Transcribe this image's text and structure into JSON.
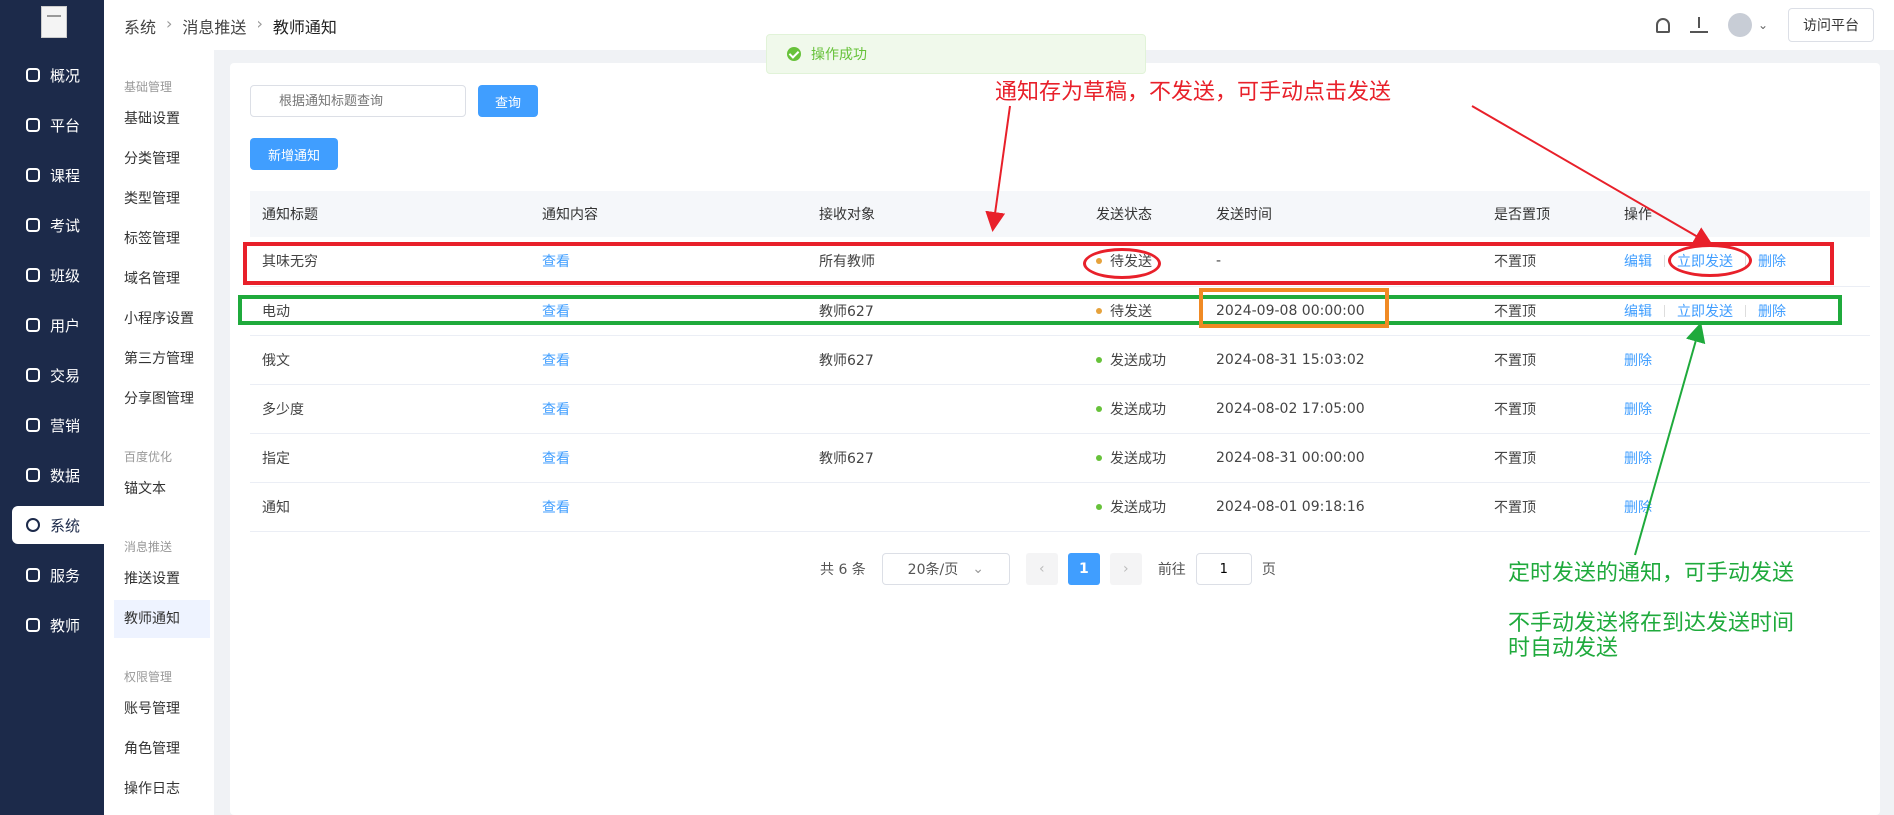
{
  "sidebar": {
    "items": [
      {
        "label": "概况",
        "icon": "pie-chart-icon"
      },
      {
        "label": "平台",
        "icon": "shop-icon"
      },
      {
        "label": "课程",
        "icon": "book-icon"
      },
      {
        "label": "考试",
        "icon": "exam-icon"
      },
      {
        "label": "班级",
        "icon": "group-icon"
      },
      {
        "label": "用户",
        "icon": "user-icon"
      },
      {
        "label": "交易",
        "icon": "yen-icon"
      },
      {
        "label": "营销",
        "icon": "megaphone-icon"
      },
      {
        "label": "数据",
        "icon": "bar-chart-icon"
      },
      {
        "label": "系统",
        "icon": "gear-icon"
      },
      {
        "label": "服务",
        "icon": "handshake-icon"
      },
      {
        "label": "教师",
        "icon": "teacher-icon"
      }
    ]
  },
  "submenu": {
    "group_basic": "基础管理",
    "basic_items": [
      "基础设置",
      "分类管理",
      "类型管理",
      "标签管理",
      "域名管理",
      "小程序设置",
      "第三方管理",
      "分享图管理"
    ],
    "group_seo": "百度优化",
    "seo_items": [
      "锚文本"
    ],
    "group_push": "消息推送",
    "push_items": [
      "推送设置",
      "教师通知"
    ],
    "group_auth": "权限管理",
    "auth_items": [
      "账号管理",
      "角色管理",
      "操作日志"
    ]
  },
  "header": {
    "breadcrumb": [
      "系统",
      "消息推送",
      "教师通知"
    ],
    "visit_label": "访问平台"
  },
  "toast": {
    "message": "操作成功"
  },
  "toolbar": {
    "search_placeholder": "根据通知标题查询",
    "query_label": "查询",
    "add_label": "新增通知"
  },
  "table": {
    "columns": [
      "通知标题",
      "通知内容",
      "接收对象",
      "发送状态",
      "发送时间",
      "是否置顶",
      "操作"
    ],
    "rows": [
      {
        "title": "其味无穷",
        "content": "查看",
        "target": "所有教师",
        "status": "待发送",
        "status_color": "#e6a23c",
        "time": "-",
        "top": "不置顶",
        "ops": [
          "编辑",
          "立即发送",
          "删除"
        ]
      },
      {
        "title": "电动",
        "content": "查看",
        "target": "教师627",
        "status": "待发送",
        "status_color": "#e6a23c",
        "time": "2024-09-08 00:00:00",
        "top": "不置顶",
        "ops": [
          "编辑",
          "立即发送",
          "删除"
        ]
      },
      {
        "title": "俄文",
        "content": "查看",
        "target": "教师627",
        "status": "发送成功",
        "status_color": "#67c23a",
        "time": "2024-08-31 15:03:02",
        "top": "不置顶",
        "ops": [
          "删除"
        ]
      },
      {
        "title": "多少度",
        "content": "查看",
        "target": "",
        "status": "发送成功",
        "status_color": "#67c23a",
        "time": "2024-08-02 17:05:00",
        "top": "不置顶",
        "ops": [
          "删除"
        ]
      },
      {
        "title": "指定",
        "content": "查看",
        "target": "教师627",
        "status": "发送成功",
        "status_color": "#67c23a",
        "time": "2024-08-31 00:00:00",
        "top": "不置顶",
        "ops": [
          "删除"
        ]
      },
      {
        "title": "通知",
        "content": "查看",
        "target": "",
        "status": "发送成功",
        "status_color": "#67c23a",
        "time": "2024-08-01 09:18:16",
        "top": "不置顶",
        "ops": [
          "删除"
        ]
      }
    ]
  },
  "pagination": {
    "total_text": "共 6 条",
    "page_size": "20条/页",
    "current_page": "1",
    "goto_label": "前往",
    "goto_value": "1",
    "page_unit": "页"
  },
  "annotations": {
    "red_note": "通知存为草稿，不发送，可手动点击发送",
    "green_note_1": "定时发送的通知，可手动发送",
    "green_note_2": "不手动发送将在到达发送时间",
    "green_note_3": "时自动发送",
    "red_color": "#e8202a",
    "green_color": "#1faa3c",
    "orange_color": "#f08a24"
  },
  "colors": {
    "primary": "#409eff",
    "sidebar_bg": "#1c2a4a"
  }
}
